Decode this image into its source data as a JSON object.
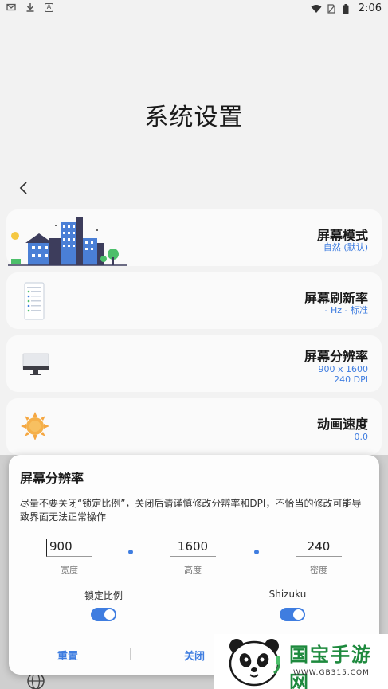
{
  "status_bar": {
    "time": "2:06",
    "left_icons": [
      "mail-icon",
      "download-icon",
      "a-icon"
    ],
    "right_icons": [
      "wifi-icon",
      "sim-icon",
      "battery-icon"
    ]
  },
  "page": {
    "title": "系统设置",
    "back_icon": "chevron-left-icon"
  },
  "cards": {
    "mode": {
      "title": "屏幕模式",
      "sub": "自然 (默认)"
    },
    "refresh": {
      "title": "屏幕刷新率",
      "sub": "- Hz - 标准"
    },
    "resolution": {
      "title": "屏幕分辨率",
      "sub1": "900 x 1600",
      "sub2": "240 DPI"
    },
    "animation": {
      "title": "动画速度",
      "sub": "0.0"
    }
  },
  "dialog": {
    "title": "屏幕分辨率",
    "message": "尽量不要关闭“锁定比例”，关闭后请谨慎修改分辨率和DPI，不恰当的修改可能导致界面无法正常操作",
    "width_value": "900",
    "width_label": "宽度",
    "height_value": "1600",
    "height_label": "高度",
    "density_value": "240",
    "density_label": "密度",
    "lock_ratio_label": "锁定比例",
    "shizuku_label": "Shizuku",
    "reset_label": "重置",
    "close_label": "关闭"
  },
  "watermark": {
    "text": "国宝手游网",
    "url": "WWW.GB315.COM"
  },
  "colors": {
    "accent": "#3f7de0",
    "background": "#f2f2f2",
    "card": "#fafafa",
    "watermark_green": "#1e8a3e"
  }
}
